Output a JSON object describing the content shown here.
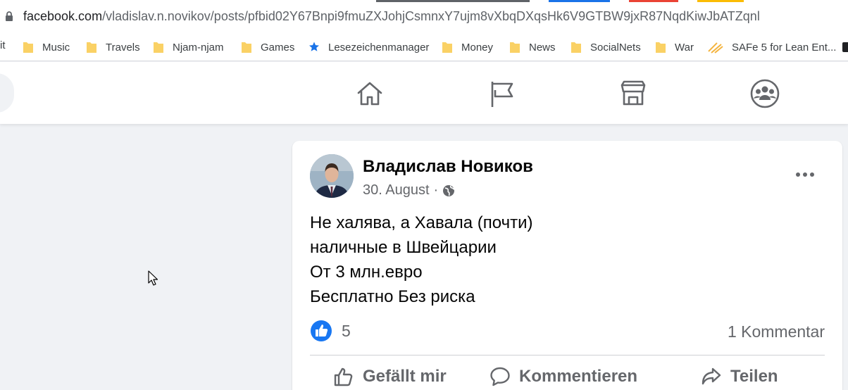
{
  "browser": {
    "url_host": "facebook.com",
    "url_path": "/vladislav.n.novikov/posts/pfbid02Y67Bnpi9fmuZXJohjCsmnxY7ujm8vXbqDXqsHk6V9GTBW9jxR87NqdKiwJbATZqnl",
    "bookmarks_edge": "it",
    "bookmarks": [
      "Music",
      "Travels",
      "Njam-njam",
      "Games",
      "Lesezeichenmanager",
      "Money",
      "News",
      "SocialNets",
      "War",
      "SAFe 5 for Lean Ent..."
    ]
  },
  "icons": {
    "nav": [
      "home-icon",
      "pages-flag-icon",
      "marketplace-icon",
      "groups-icon"
    ],
    "folder_color": "#fad165",
    "star_color": "#1a73e8",
    "reaction_color": "#1877f2"
  },
  "post": {
    "author": "Владислав Новиков",
    "date": "30. August",
    "date_separator": "·",
    "lines": [
      "Не халява, а Хавала (почти)",
      "наличные в Швейцарии",
      "От 3 млн.евро",
      "Бесплатно Без риска"
    ],
    "reaction_count": "5",
    "comment_count": "1 Kommentar",
    "actions": {
      "like": "Gefällt mir",
      "comment": "Kommentieren",
      "share": "Teilen"
    }
  }
}
